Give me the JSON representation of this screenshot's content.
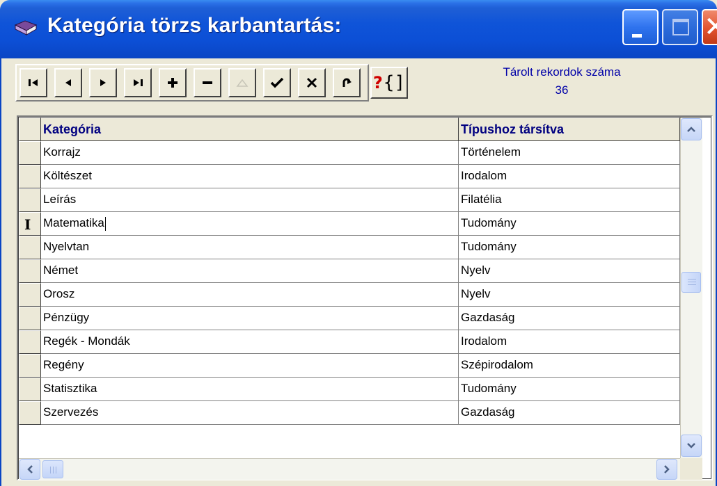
{
  "window": {
    "title": "Kategória törzs karbantartás:"
  },
  "toolbar": {
    "buttons": [
      {
        "name": "first-record-button",
        "icon": "first-record-icon"
      },
      {
        "name": "prior-record-button",
        "icon": "prior-record-icon"
      },
      {
        "name": "next-record-button",
        "icon": "next-record-icon"
      },
      {
        "name": "last-record-button",
        "icon": "last-record-icon"
      },
      {
        "name": "insert-record-button",
        "icon": "plus-icon"
      },
      {
        "name": "delete-record-button",
        "icon": "minus-icon"
      },
      {
        "name": "edit-record-button",
        "icon": "triangle-up-icon",
        "disabled": true
      },
      {
        "name": "post-record-button",
        "icon": "check-icon"
      },
      {
        "name": "cancel-record-button",
        "icon": "x-icon"
      },
      {
        "name": "refresh-button",
        "icon": "refresh-icon"
      }
    ],
    "help_q": "?",
    "help_b": "{]"
  },
  "records": {
    "label": "Tárolt rekordok száma",
    "count": "36"
  },
  "grid": {
    "columns": [
      "Kategória",
      "Típushoz társítva"
    ],
    "rows": [
      {
        "kategoria": "Korrajz",
        "tipus": "Történelem"
      },
      {
        "kategoria": "Költészet",
        "tipus": "Irodalom"
      },
      {
        "kategoria": "Leírás",
        "tipus": "Filatélia"
      },
      {
        "kategoria": "Matematika",
        "tipus": "Tudomány",
        "current": true
      },
      {
        "kategoria": "Nyelvtan",
        "tipus": "Tudomány"
      },
      {
        "kategoria": "Német",
        "tipus": "Nyelv"
      },
      {
        "kategoria": "Orosz",
        "tipus": "Nyelv"
      },
      {
        "kategoria": "Pénzügy",
        "tipus": "Gazdaság"
      },
      {
        "kategoria": "Regék - Mondák",
        "tipus": "Irodalom"
      },
      {
        "kategoria": "Regény",
        "tipus": "Szépirodalom"
      },
      {
        "kategoria": "Statisztika",
        "tipus": "Tudomány"
      },
      {
        "kategoria": "Szervezés",
        "tipus": "Gazdaság"
      }
    ],
    "current_marker": "I"
  },
  "colors": {
    "titlebar": "#0c4fd6",
    "header_text": "#000080",
    "record_text": "#0000a8",
    "face": "#ece9d8"
  }
}
